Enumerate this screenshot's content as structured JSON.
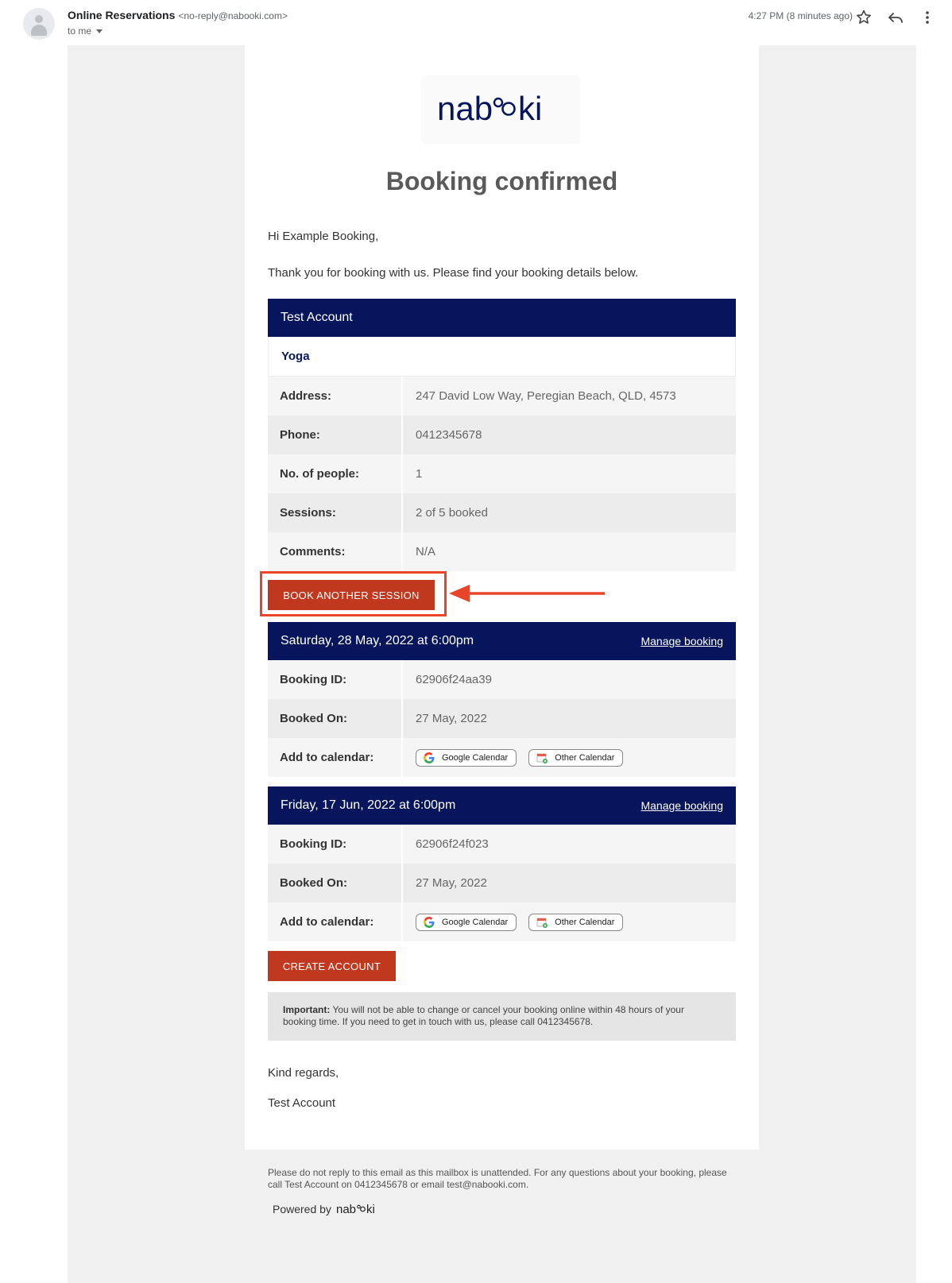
{
  "email": {
    "sender_name": "Online Reservations",
    "sender_email": "<no-reply@nabooki.com>",
    "to_line": "to me",
    "timestamp": "4:27 PM (8 minutes ago)"
  },
  "brand": {
    "logo_text": "nabooki",
    "navy": "#06155c",
    "accent_red": "#c0391f",
    "highlight": "#e8452b"
  },
  "body": {
    "heading": "Booking confirmed",
    "greeting": "Hi Example Booking,",
    "intro": "Thank you for booking with us. Please find your booking details below."
  },
  "account": {
    "name": "Test Account",
    "service": "Yoga",
    "details": [
      {
        "label": "Address:",
        "value": "247 David Low Way, Peregian Beach, QLD, 4573"
      },
      {
        "label": "Phone:",
        "value": "0412345678"
      },
      {
        "label": "No. of people:",
        "value": "1"
      },
      {
        "label": "Sessions:",
        "value": "2 of 5 booked"
      },
      {
        "label": "Comments:",
        "value": "N/A"
      }
    ]
  },
  "book_another_label": "BOOK ANOTHER SESSION",
  "bookings": [
    {
      "datetime": "Saturday, 28 May, 2022 at 6:00pm",
      "manage_label": "Manage booking",
      "rows": [
        {
          "label": "Booking ID:",
          "value": "62906f24aa39"
        },
        {
          "label": "Booked On:",
          "value": "27 May, 2022"
        },
        {
          "label": "Add to calendar:"
        }
      ],
      "google_calendar_label": "Google Calendar",
      "other_calendar_label": "Other Calendar"
    },
    {
      "datetime": "Friday, 17 Jun, 2022 at 6:00pm",
      "manage_label": "Manage booking",
      "rows": [
        {
          "label": "Booking ID:",
          "value": "62906f24f023"
        },
        {
          "label": "Booked On:",
          "value": "27 May, 2022"
        },
        {
          "label": "Add to calendar:"
        }
      ],
      "google_calendar_label": "Google Calendar",
      "other_calendar_label": "Other Calendar"
    }
  ],
  "create_account_label": "CREATE ACCOUNT",
  "important": {
    "label": "Important:",
    "text": "You will not be able to change or cancel your booking online within 48 hours of your booking time. If you need to get in touch with us, please call 0412345678."
  },
  "closing": {
    "regards": "Kind regards,",
    "signature": "Test Account"
  },
  "footer": {
    "text": "Please do not reply to this email as this mailbox is unattended. For any questions about your booking, please call Test Account on 0412345678 or email test@nabooki.com.",
    "powered_by": "Powered by"
  },
  "icons": [
    "avatar-icon",
    "star-icon",
    "reply-icon",
    "more-vert-icon",
    "chevron-down-icon",
    "google-icon",
    "calendar-icon",
    "arrow-left-icon"
  ]
}
